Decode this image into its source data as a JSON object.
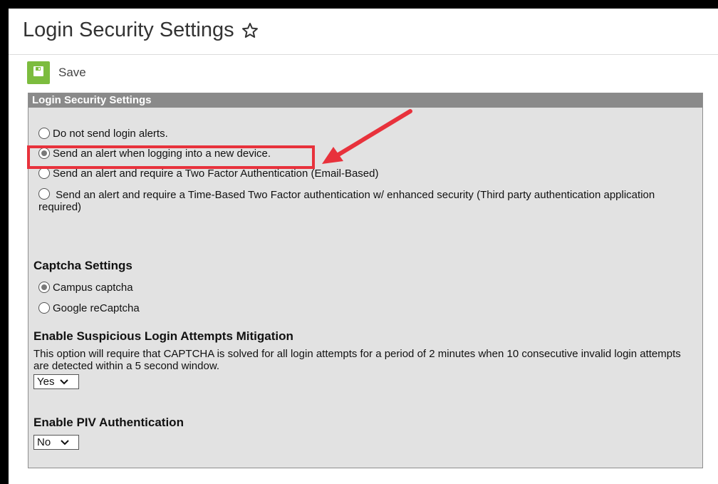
{
  "header": {
    "title": "Login Security Settings"
  },
  "toolbar": {
    "save_label": "Save"
  },
  "panel": {
    "title": "Login Security Settings",
    "alert_options": [
      {
        "label": "Do not send login alerts.",
        "checked": false
      },
      {
        "label": "Send an alert when logging into a new device.",
        "checked": true
      },
      {
        "label": "Send an alert and require a Two Factor Authentication (Email-Based)",
        "checked": false
      },
      {
        "label": "Send an alert and require a Time-Based Two Factor authentication w/ enhanced security (Third party authentication application required)",
        "checked": false
      }
    ],
    "captcha": {
      "title": "Captcha Settings",
      "options": [
        {
          "label": "Campus captcha",
          "checked": true
        },
        {
          "label": "Google reCaptcha",
          "checked": false
        }
      ]
    },
    "suspicious": {
      "title": "Enable Suspicious Login Attempts Mitigation",
      "description": "This option will require that CAPTCHA is solved for all login attempts for a period of 2 minutes when 10 consecutive invalid login attempts are detected within a 5 second window.",
      "value": "Yes"
    },
    "piv": {
      "title": "Enable PIV Authentication",
      "value": "No"
    }
  },
  "colors": {
    "accent_green": "#7cbc3e",
    "annotation_red": "#e8323c",
    "panel_bg": "#e2e2e2",
    "panel_header": "#8a8a8a"
  }
}
